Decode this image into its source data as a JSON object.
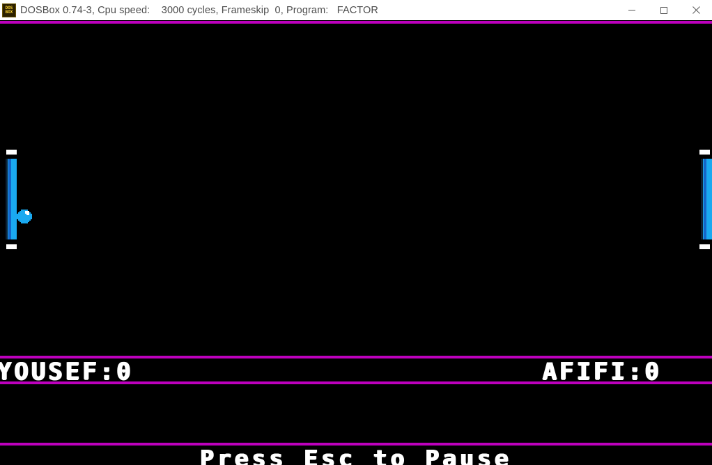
{
  "window": {
    "title": "DOSBox 0.74-3, Cpu speed:    3000 cycles, Frameskip  0, Program:   FACTOR",
    "icon_name": "dosbox-icon",
    "icon_line1": "DOS",
    "icon_line2": "BOX",
    "titlebar_bg": "#ffffff",
    "title_color": "#4d4d4d",
    "controls": [
      {
        "name": "minimize-button",
        "label": "Minimize"
      },
      {
        "name": "maximize-button",
        "label": "Maximize"
      },
      {
        "name": "close-button",
        "label": "Close"
      }
    ]
  },
  "game": {
    "name": "FACTOR",
    "background": "#000000",
    "border_color": "#bd00bd",
    "paddle_color": "#1aa9f0",
    "paddle_stripe_color": "#1565c8",
    "ball_color": "#1aa9f0",
    "ball_highlight_color": "#ffffff",
    "tick_color": "#ffffff",
    "text_color": "#ffffff",
    "scoreboard": {
      "left_player": "YOUSEF",
      "left_score": "0",
      "left_display": "YOUSEF:0",
      "right_player": "AFIFI",
      "right_score": "0",
      "right_display": "AFIFI:0"
    },
    "footer": {
      "hint": "Press Esc to Pause"
    },
    "objects": {
      "paddle_left_label": "left-paddle",
      "paddle_right_label": "right-paddle",
      "ball_label": "ball"
    }
  }
}
